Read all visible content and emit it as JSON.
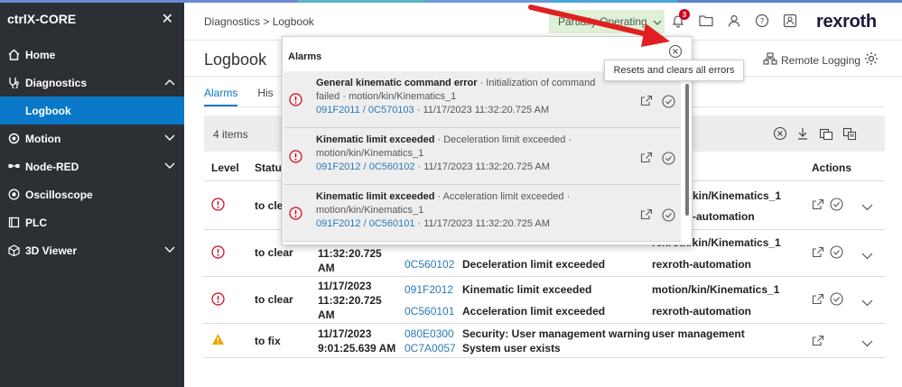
{
  "colors": {
    "sidebar_bg": "#2c2f33",
    "accent": "#0a78c8",
    "status_bg": "#dff0d8",
    "error": "#d0021b",
    "warning": "#f0a30a",
    "arrow": "#e02020"
  },
  "sidebar": {
    "brand": "ctrlX-CORE",
    "items": [
      {
        "label": "Home",
        "icon": "home-icon"
      },
      {
        "label": "Diagnostics",
        "icon": "diagnostics-icon"
      },
      {
        "label": "Logbook"
      },
      {
        "label": "Motion",
        "icon": "motion-icon"
      },
      {
        "label": "Node-RED",
        "icon": "node-red-icon"
      },
      {
        "label": "Oscilloscope",
        "icon": "oscilloscope-icon"
      },
      {
        "label": "PLC",
        "icon": "plc-icon"
      },
      {
        "label": "3D Viewer",
        "icon": "cube-icon"
      }
    ]
  },
  "header": {
    "breadcrumb": "Diagnostics > Logbook",
    "status": "Partially Operating",
    "notification_count": "3",
    "logo": "rexroth"
  },
  "page": {
    "title": "Logbook",
    "remote_logging": "Remote Logging",
    "tabs": [
      {
        "label": "Alarms"
      },
      {
        "label": "His"
      }
    ],
    "items_count": "4 items",
    "columns": {
      "level": "Level",
      "status": "Status",
      "actions": "Actions"
    }
  },
  "rows": [
    {
      "status": "to clea",
      "line1": "kin/Kinematics_1",
      "line2": "-automation"
    },
    {
      "status": "to clear",
      "time": "11:32:20.725",
      "ampm": "AM",
      "code2": "0C560102",
      "text2": "Deceleration limit exceeded",
      "source1": "rexroth/kin/Kinematics_1",
      "source2": "rexroth-automation"
    },
    {
      "status": "to clear",
      "date": "11/17/2023",
      "time": "11:32:20.725",
      "ampm": "AM",
      "code1": "091F2012",
      "text1": "Kinematic limit exceeded",
      "code2": "0C560101",
      "text2": "Acceleration limit exceeded",
      "source1": "motion/kin/Kinematics_1",
      "source2": "rexroth-automation"
    },
    {
      "status": "to fix",
      "date": "11/17/2023",
      "time": "9:01:25.639 AM",
      "code1": "080E0300",
      "text1": "Security: User management warning",
      "code2": "0C7A0057",
      "text2": "System user exists",
      "source1": "user management"
    }
  ],
  "popup": {
    "title": "Alarms",
    "alarms": [
      {
        "title": "General kinematic command error",
        "desc": " · Initialization of command failed · motion/kin/Kinematics_1",
        "code": "091F2011 / 0C570103",
        "timestamp": " · 11/17/2023 11:32:20.725 AM"
      },
      {
        "title": "Kinematic limit exceeded",
        "desc": " · Deceleration limit exceeded · motion/kin/Kinematics_1",
        "code": "091F2012 / 0C560102",
        "timestamp": " · 11/17/2023 11:32:20.725 AM"
      },
      {
        "title": "Kinematic limit exceeded",
        "desc": " · Acceleration limit exceeded · motion/kin/Kinematics_1",
        "code": "091F2012 / 0C560101",
        "timestamp": " · 11/17/2023 11:32:20.725 AM"
      }
    ],
    "tooltip": "Resets and clears all errors"
  }
}
